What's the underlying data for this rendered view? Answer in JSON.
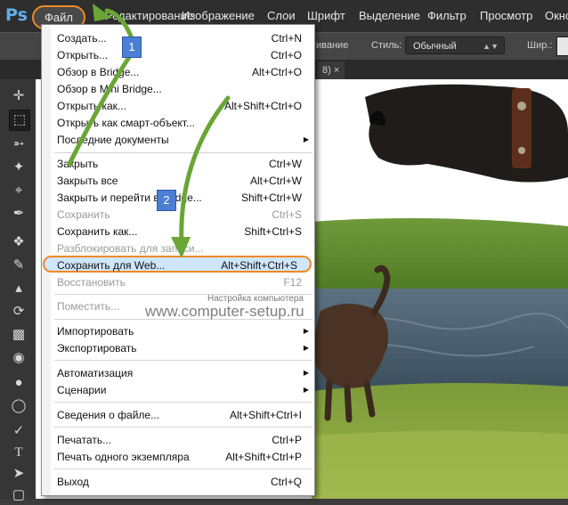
{
  "app": {
    "logo": "Ps"
  },
  "menubar": {
    "items": [
      "Файл",
      "Редактирование",
      "Изображение",
      "Слои",
      "Шрифт",
      "Выделение",
      "Фильтр",
      "Просмотр",
      "Окно"
    ]
  },
  "options_bar": {
    "partial_label": "ивание",
    "style_label": "Стиль:",
    "style_value": "Обычный",
    "width_label": "Шир.:"
  },
  "tab": {
    "partial_label": "8) ×"
  },
  "file_menu": {
    "items": [
      {
        "label": "Создать...",
        "shortcut": "Ctrl+N"
      },
      {
        "label": "Открыть...",
        "shortcut": "Ctrl+O"
      },
      {
        "label": "Обзор в Bridge...",
        "shortcut": "Alt+Ctrl+O"
      },
      {
        "label": "Обзор в Mini Bridge...",
        "shortcut": ""
      },
      {
        "label": "Открыть как...",
        "shortcut": "Alt+Shift+Ctrl+O"
      },
      {
        "label": "Открыть как смарт-объект...",
        "shortcut": ""
      },
      {
        "label": "Последние документы",
        "shortcut": "",
        "submenu": true
      },
      {
        "label": "Закрыть",
        "shortcut": "Ctrl+W"
      },
      {
        "label": "Закрыть все",
        "shortcut": "Alt+Ctrl+W"
      },
      {
        "label": "Закрыть и перейти в Bridge...",
        "shortcut": "Shift+Ctrl+W"
      },
      {
        "label": "Сохранить",
        "shortcut": "Ctrl+S",
        "disabled": true
      },
      {
        "label": "Сохранить как...",
        "shortcut": "Shift+Ctrl+S"
      },
      {
        "label": "Разблокировать для записи...",
        "shortcut": "",
        "disabled": true
      },
      {
        "label": "Сохранить для Web...",
        "shortcut": "Alt+Shift+Ctrl+S",
        "highlighted": true
      },
      {
        "label": "Восстановить",
        "shortcut": "F12",
        "disabled": true
      },
      {
        "label": "Поместить...",
        "shortcut": "",
        "disabled": true
      },
      {
        "label": "Импортировать",
        "shortcut": "",
        "submenu": true
      },
      {
        "label": "Экспортировать",
        "shortcut": "",
        "submenu": true
      },
      {
        "label": "Автоматизация",
        "shortcut": "",
        "submenu": true
      },
      {
        "label": "Сценарии",
        "shortcut": "",
        "submenu": true
      },
      {
        "label": "Сведения о файле...",
        "shortcut": "Alt+Shift+Ctrl+I"
      },
      {
        "label": "Печатать...",
        "shortcut": "Ctrl+P"
      },
      {
        "label": "Печать одного экземпляра",
        "shortcut": "Alt+Shift+Ctrl+P"
      },
      {
        "label": "Выход",
        "shortcut": "Ctrl+Q"
      }
    ]
  },
  "watermark": {
    "small": "Настройка компьютера",
    "big": "www.computer-setup.ru"
  },
  "annotations": {
    "step1": "1",
    "step2": "2"
  },
  "colors": {
    "highlight_ring": "#f08a24",
    "arrow": "#6aa636",
    "badge": "#4a7fd4",
    "menu_highlight": "#cfe6ff"
  },
  "toolbar_icons": [
    "move-tool-icon",
    "marquee-tool-icon",
    "lasso-tool-icon",
    "quick-select-icon",
    "crop-tool-icon",
    "eyedropper-icon",
    "healing-brush-icon",
    "brush-tool-icon",
    "clone-stamp-icon",
    "history-brush-icon",
    "eraser-icon",
    "paint-bucket-icon",
    "blur-tool-icon",
    "dodge-tool-icon",
    "pen-tool-icon",
    "type-tool-icon",
    "path-select-icon",
    "shape-tool-icon"
  ]
}
